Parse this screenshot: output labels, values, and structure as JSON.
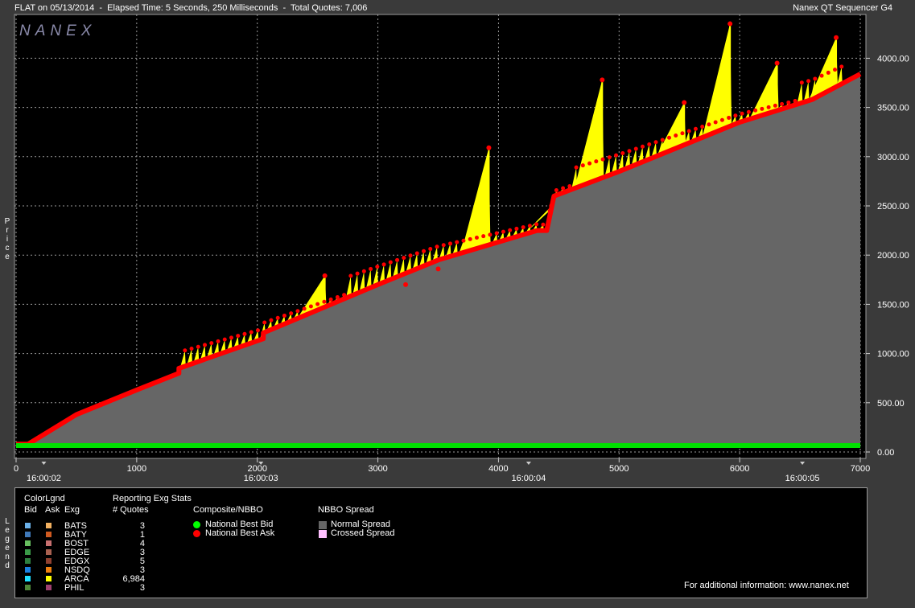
{
  "header": {
    "left": "FLAT on 05/13/2014  -  Elapsed Time: 5 Seconds, 250 Milliseconds  -  Total Quotes: 7,006",
    "right": "Nanex QT Sequencer G4"
  },
  "logo": "NANEX",
  "price_axis_label": "Price",
  "legend_axis_label": "Legend",
  "chart_data": {
    "type": "line",
    "title": "FLAT on 05/13/2014  -  Elapsed Time: 5 Seconds, 250 Milliseconds  -  Total Quotes: 7,006",
    "ylabel": "Price",
    "xlim": [
      0,
      7000
    ],
    "ylim": [
      -50,
      4400
    ],
    "x_ticks": [
      0,
      1000,
      2000,
      3000,
      4000,
      5000,
      6000,
      7000
    ],
    "x_tick_labels": [
      "0",
      "1000",
      "2000",
      "3000",
      "4000",
      "5000",
      "6000",
      "7000"
    ],
    "time_ticks": [
      {
        "x": 230,
        "label": "16:00:02"
      },
      {
        "x": 2030,
        "label": "16:00:03"
      },
      {
        "x": 4250,
        "label": "16:00:04"
      },
      {
        "x": 6520,
        "label": "16:00:05"
      }
    ],
    "y_ticks": [
      0,
      500,
      1000,
      1500,
      2000,
      2500,
      3000,
      3500,
      4000
    ],
    "y_tick_labels": [
      "0.00",
      "500.00",
      "1000.00",
      "1500.00",
      "2000.00",
      "2500.00",
      "3000.00",
      "3500.00",
      "4000.00"
    ],
    "grid": true,
    "series": [
      {
        "name": "National Best Bid",
        "color": "#00e000",
        "x": [
          0,
          7000
        ],
        "y": [
          65,
          65
        ]
      },
      {
        "name": "National Best Ask",
        "color": "#ff0000",
        "x": [
          0,
          100,
          500,
          1000,
          1350,
          1350,
          2050,
          2050,
          3000,
          3500,
          4320,
          4400,
          4460,
          5000,
          6000,
          6600,
          7000
        ],
        "y": [
          80,
          80,
          380,
          630,
          800,
          850,
          1150,
          1210,
          1700,
          1950,
          2250,
          2250,
          2600,
          2850,
          3350,
          3580,
          3840
        ]
      }
    ],
    "ask_spikes": [
      {
        "x": 2560,
        "y": 1790
      },
      {
        "x": 3230,
        "y": 1700
      },
      {
        "x": 3500,
        "y": 1860
      },
      {
        "x": 3920,
        "y": 3090
      },
      {
        "x": 4440,
        "y": 2500
      },
      {
        "x": 4860,
        "y": 3780
      },
      {
        "x": 5540,
        "y": 3550
      },
      {
        "x": 5920,
        "y": 4350
      },
      {
        "x": 6310,
        "y": 3950
      },
      {
        "x": 6800,
        "y": 4210
      }
    ],
    "spread_colors": {
      "Normal Spread": "#666666",
      "Crossed Spread": "#ffb0ff",
      "ARCA": "#ffff00"
    }
  },
  "legend": {
    "color_legend_title": "ColorLgnd",
    "headers": {
      "bid": "Bid",
      "ask": "Ask",
      "exg": "Exg"
    },
    "stats_title": "Reporting Exg Stats",
    "quotes_header": "# Quotes",
    "exchanges": [
      {
        "name": "BATS",
        "quotes": "3",
        "bid_color": "#6ab0e8",
        "ask_color": "#f2b060"
      },
      {
        "name": "BATY",
        "quotes": "1",
        "bid_color": "#3f78b8",
        "ask_color": "#d05a20"
      },
      {
        "name": "BOST",
        "quotes": "4",
        "bid_color": "#68c060",
        "ask_color": "#c87070"
      },
      {
        "name": "EDGE",
        "quotes": "3",
        "bid_color": "#3a9a48",
        "ask_color": "#a86050"
      },
      {
        "name": "EDGX",
        "quotes": "5",
        "bid_color": "#2e8040",
        "ask_color": "#904030"
      },
      {
        "name": "NSDQ",
        "quotes": "3",
        "bid_color": "#1a80e0",
        "ask_color": "#f08010"
      },
      {
        "name": "ARCA",
        "quotes": "6,984",
        "bid_color": "#20e0ff",
        "ask_color": "#ffff00"
      },
      {
        "name": "PHIL",
        "quotes": "3",
        "bid_color": "#508838",
        "ask_color": "#a04070"
      }
    ],
    "composite_title": "Composite/NBBO",
    "composite_items": [
      {
        "label": "National Best Bid",
        "color": "#00ff00"
      },
      {
        "label": "National Best Ask",
        "color": "#ff0000"
      }
    ],
    "spread_title": "NBBO Spread",
    "spread_items": [
      {
        "label": "Normal Spread",
        "color": "#666666"
      },
      {
        "label": "Crossed Spread",
        "color": "#ffc0ff"
      }
    ],
    "footer": "For additional information: www.nanex.net"
  }
}
